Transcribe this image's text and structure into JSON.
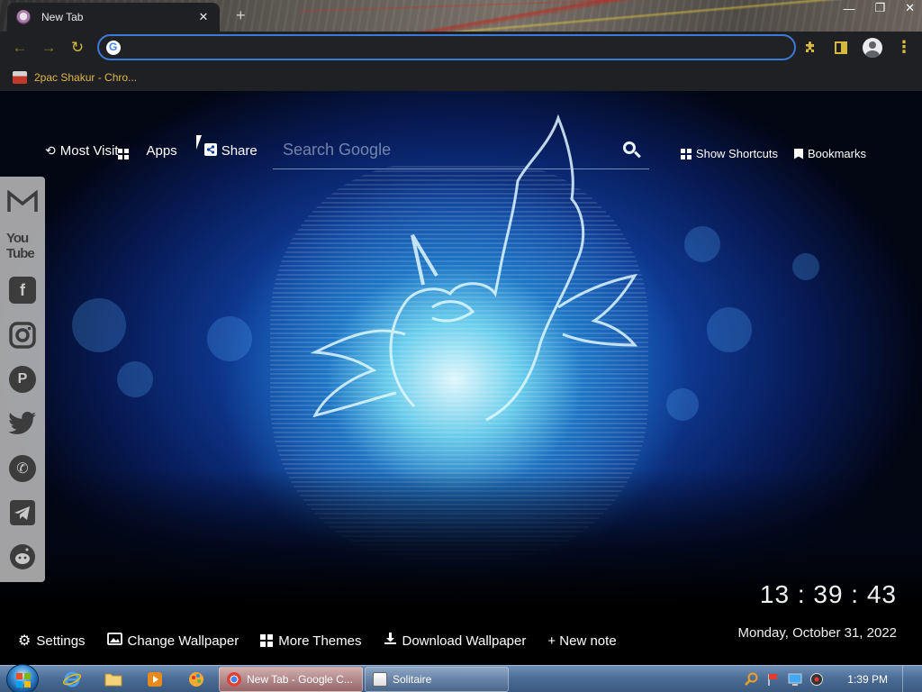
{
  "browser": {
    "tab": {
      "title": "New Tab",
      "close": "✕"
    },
    "new_tab_glyph": "+",
    "window_controls": [
      "—",
      "❐",
      "✕"
    ],
    "omnibox": {
      "value": "",
      "placeholder": ""
    },
    "bookmarks_bar": [
      {
        "label": "2pac Shakur - Chro..."
      }
    ],
    "toolbar_icons": [
      "back-arrow-icon",
      "forward-arrow-icon",
      "reload-icon",
      "extensions-icon",
      "side-panel-icon",
      "profile-icon",
      "menu-icon"
    ]
  },
  "newtab": {
    "top_links": [
      {
        "label": "Most Visit",
        "icon": "history-icon"
      },
      {
        "label": "Apps",
        "icon": "apps-grid-icon"
      },
      {
        "label": "Share",
        "icon": "share-icon"
      }
    ],
    "search": {
      "placeholder": "Search Google",
      "value": ""
    },
    "right_links": [
      {
        "label": "Show Shortcuts",
        "icon": "windows-grid-icon"
      },
      {
        "label": "Bookmarks",
        "icon": "bookmark-icon"
      }
    ],
    "social_sidebar": [
      "gmail-icon",
      "youtube-icon",
      "facebook-icon",
      "instagram-icon",
      "pinterest-icon",
      "twitter-icon",
      "whatsapp-icon",
      "telegram-icon",
      "reddit-icon"
    ],
    "social_text": {
      "youtube": "You Tube"
    },
    "clock": "13 : 39 : 43",
    "date": "Monday, October 31, 2022",
    "bottom_links": [
      {
        "label": "Settings",
        "icon": "gear-icon"
      },
      {
        "label": "Change Wallpaper",
        "icon": "image-icon"
      },
      {
        "label": "More Themes",
        "icon": "grid-icon"
      },
      {
        "label": "Download Wallpaper",
        "icon": "download-icon"
      },
      {
        "label": "+ New note",
        "icon": ""
      }
    ]
  },
  "taskbar": {
    "tasks": [
      {
        "label": "New Tab - Google C...",
        "active": true
      },
      {
        "label": "Solitaire",
        "active": false
      }
    ],
    "time": "1:39 PM"
  },
  "colors": {
    "accent_gold": "#d6b83c",
    "omnibox_border": "#3b7bd8",
    "chrome_dark": "#1f2023",
    "wallpaper_glow": "#78e1f5"
  }
}
